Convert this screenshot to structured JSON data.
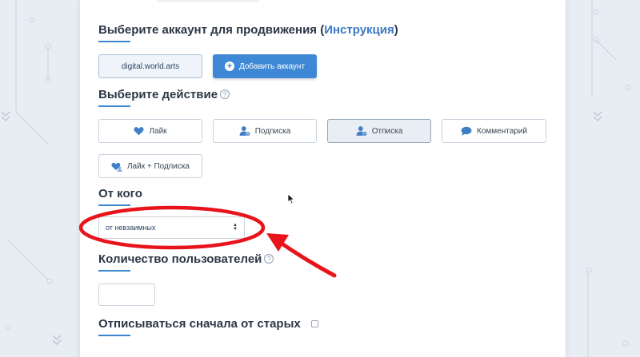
{
  "account_section": {
    "title_prefix": "Выберите аккаунт для продвижения (",
    "title_link": "Инструкция",
    "title_suffix": ")",
    "account_name": "digital.world.arts",
    "add_account_label": "Добавить аккаунт"
  },
  "action_section": {
    "title": "Выберите действие",
    "help": "?",
    "actions": [
      {
        "label": "Лайк",
        "icon": "heart-icon"
      },
      {
        "label": "Подписка",
        "icon": "user-plus-icon"
      },
      {
        "label": "Отписка",
        "icon": "user-minus-icon",
        "selected": true
      },
      {
        "label": "Комментарий",
        "icon": "comment-icon"
      },
      {
        "label": "Лайк + Подписка",
        "icon": "heart-user-icon"
      }
    ]
  },
  "from_section": {
    "title": "От кого",
    "selected_value": "от невзаимных"
  },
  "count_section": {
    "title": "Количество пользователей",
    "help": "?",
    "value": ""
  },
  "order_section": {
    "title": "Отписываться сначала от старых"
  },
  "colors": {
    "accent": "#3f88d6",
    "annotation": "#e8141c",
    "heading": "#2c3745"
  }
}
